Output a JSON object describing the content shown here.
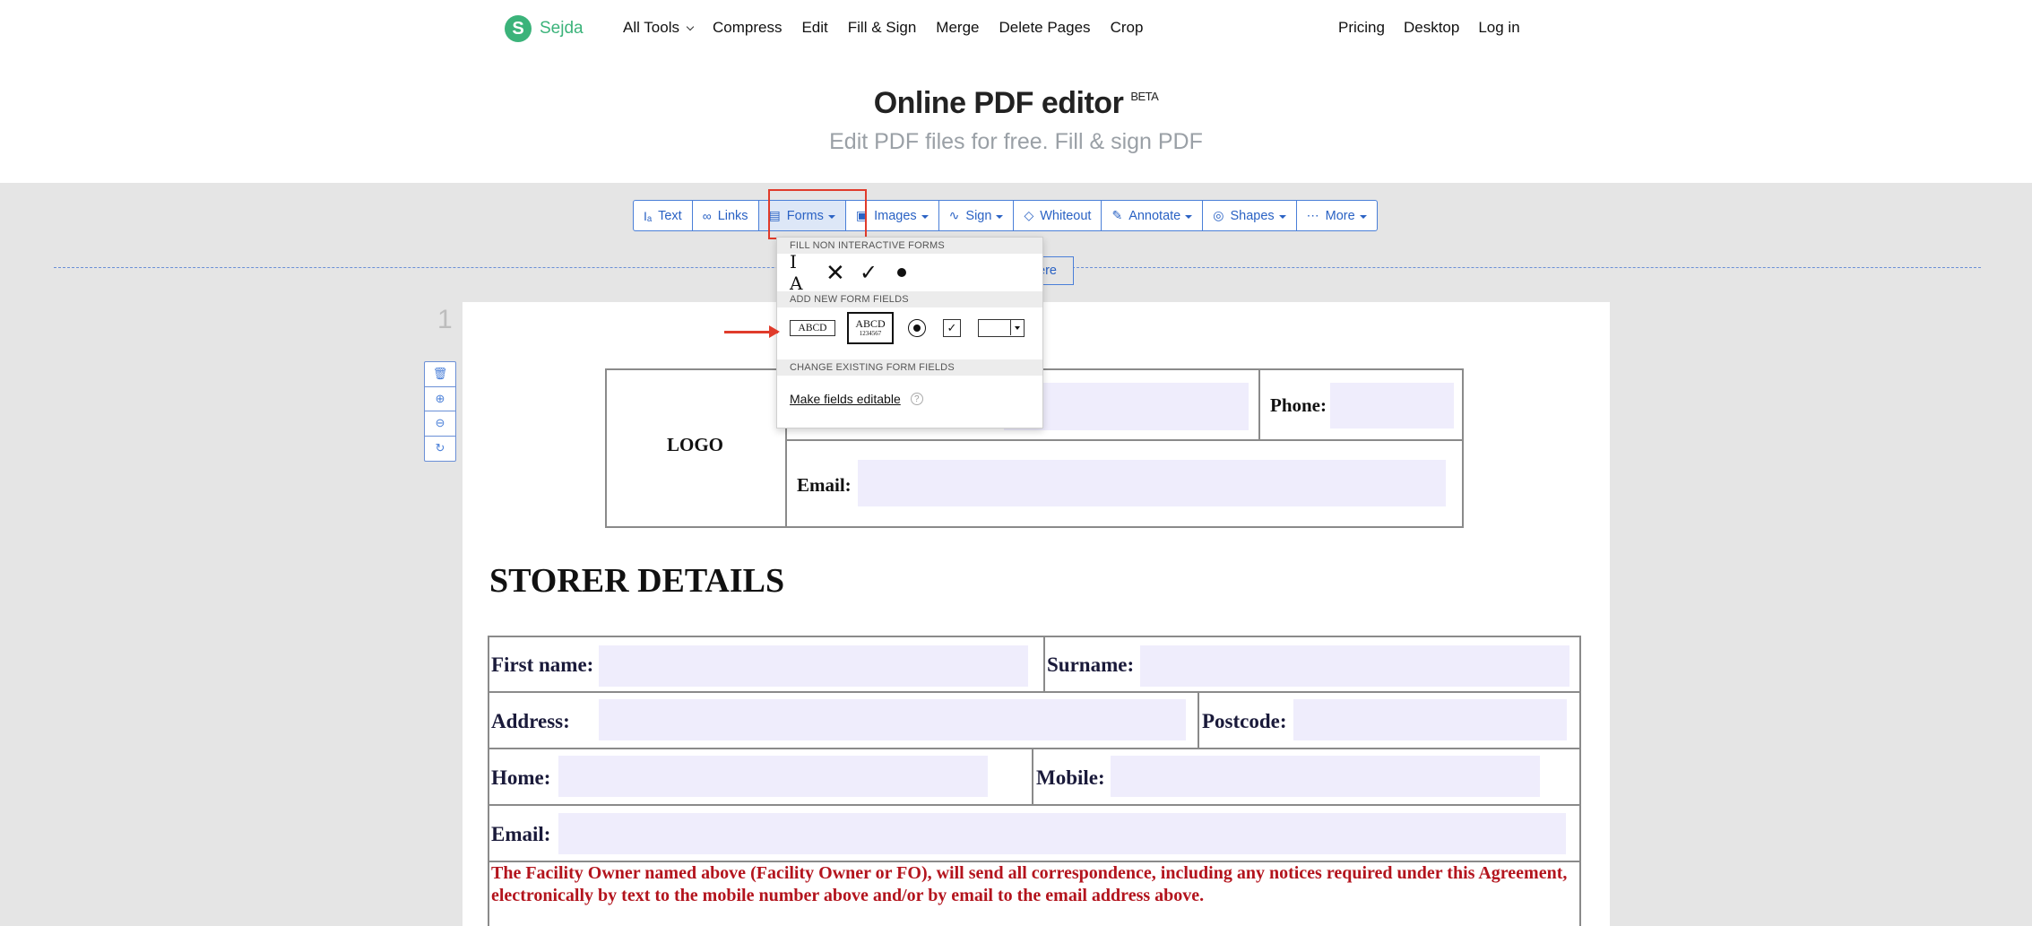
{
  "brand": {
    "logo_letter": "S",
    "name": "Sejda"
  },
  "nav": {
    "left": [
      "All Tools",
      "Compress",
      "Edit",
      "Fill & Sign",
      "Merge",
      "Delete Pages",
      "Crop"
    ],
    "right": [
      "Pricing",
      "Desktop",
      "Log in"
    ]
  },
  "hero": {
    "title": "Online PDF editor",
    "badge": "BETA",
    "subtitle": "Edit PDF files for free. Fill & sign PDF"
  },
  "toolbar": {
    "text": "Text",
    "links": "Links",
    "forms": "Forms",
    "images": "Images",
    "sign": "Sign",
    "whiteout": "Whiteout",
    "annotate": "Annotate",
    "shapes": "Shapes",
    "more": "More"
  },
  "upload_hint": "ere",
  "forms_menu": {
    "fill_heading": "FILL NON INTERACTIVE FORMS",
    "text_cursor_glyph": "I A",
    "x_glyph": "✕",
    "check_glyph": "✓",
    "add_heading": "ADD NEW FORM FIELDS",
    "text_field_sample": "ABCD",
    "multiline_sample_1": "ABCD",
    "multiline_sample_2": "1234567",
    "checkbox_glyph": "✓",
    "change_heading": "CHANGE EXISTING FORM FIELDS",
    "make_editable": "Make fields editable",
    "help_glyph": "?"
  },
  "page": {
    "number": "1",
    "header_table": {
      "logo": "LOGO",
      "phone": "Phone:",
      "email": "Email:"
    },
    "section_title": "STORER DETAILS",
    "storer": {
      "first_name": "First name:",
      "surname": "Surname:",
      "address": "Address:",
      "postcode": "Postcode:",
      "home": "Home:",
      "mobile": "Mobile:",
      "email": "Email:"
    },
    "notice": "The Facility Owner named above (Facility Owner or FO), will send all correspondence, including any notices required under this Agreement, electronically by text to the mobile number above and/or by email to the email address above."
  },
  "colors": {
    "brand_green": "#3bb37a",
    "toolbar_blue": "#2a62c4",
    "highlight_red": "#e03b2b",
    "field_fill": "#efedfc",
    "notice_red": "#b3141d"
  }
}
